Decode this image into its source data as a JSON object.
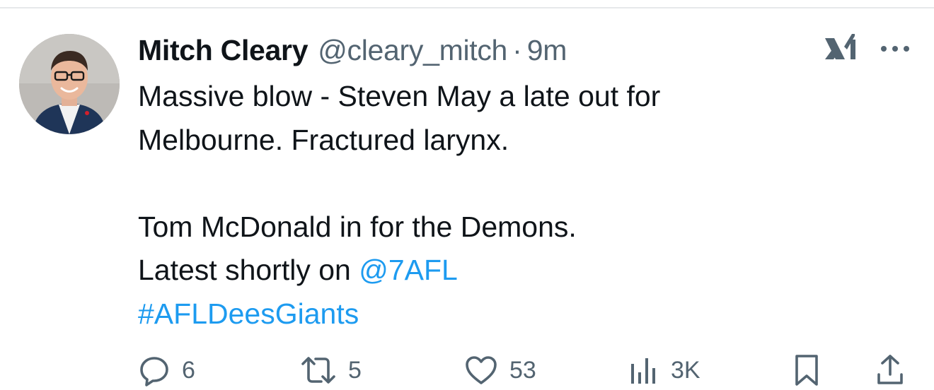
{
  "tweet": {
    "author": {
      "display_name": "Mitch Cleary",
      "handle": "@cleary_mitch",
      "separator": "·",
      "time": "9m",
      "avatar_icon": "profile-photo"
    },
    "body": {
      "line1": "Massive blow - Steven May a late out for",
      "line2": "Melbourne. Fractured larynx.",
      "line3": "Tom McDonald in for the Demons.",
      "line4_text": "Latest shortly on ",
      "line4_mention": "@7AFL",
      "line5_hashtag": "#AFLDeesGiants"
    },
    "actions": {
      "replies": "6",
      "retweets": "5",
      "likes": "53",
      "views": "3K"
    }
  },
  "colors": {
    "text": "#0f1419",
    "secondary": "#536471",
    "link": "#1d9bf0",
    "divider": "#e6e8ea"
  },
  "icons": {
    "grok": "grok-icon",
    "more": "more-icon",
    "reply": "reply-icon",
    "retweet": "retweet-icon",
    "like": "heart-icon",
    "views": "views-chart-icon",
    "bookmark": "bookmark-icon",
    "share": "share-icon"
  }
}
